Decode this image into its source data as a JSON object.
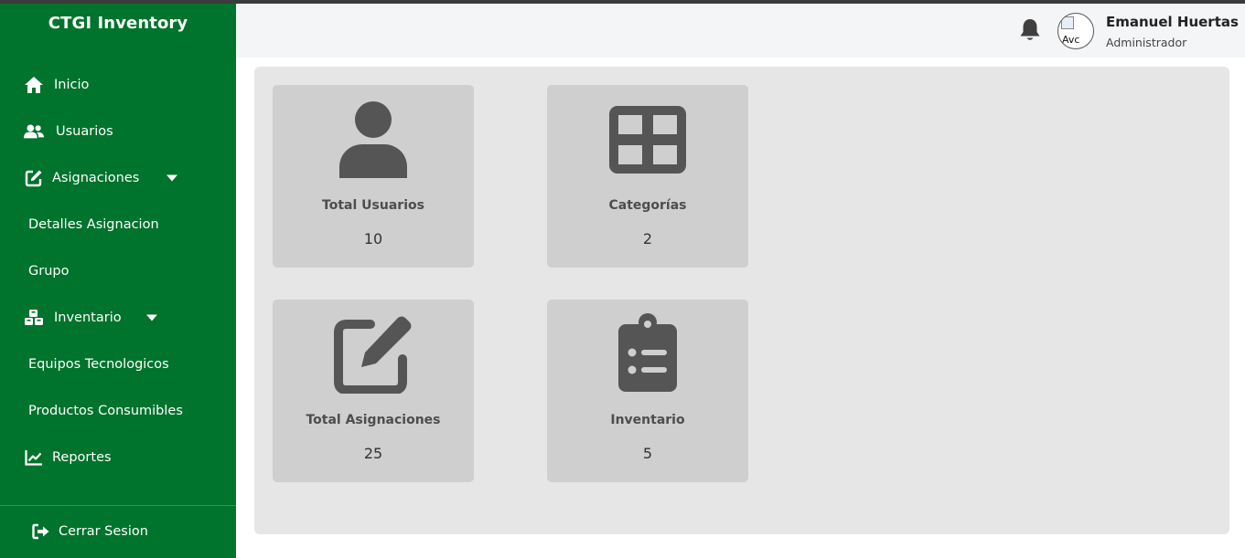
{
  "app": {
    "brand": "CTGI Inventory"
  },
  "sidebar": {
    "items": [
      {
        "label": "Inicio",
        "icon": "home-icon"
      },
      {
        "label": "Usuarios",
        "icon": "users-icon"
      },
      {
        "label": "Asignaciones",
        "icon": "edit-icon",
        "expandable": true
      },
      {
        "label": "Detalles Asignacion",
        "sub": true
      },
      {
        "label": "Grupo",
        "sub": true
      },
      {
        "label": "Inventario",
        "icon": "cubes-icon",
        "expandable": true
      },
      {
        "label": "Equipos Tecnologicos",
        "sub": true
      },
      {
        "label": "Productos Consumibles",
        "sub": true
      },
      {
        "label": "Reportes",
        "icon": "chart-line-icon"
      }
    ],
    "logout": {
      "label": "Cerrar Sesion",
      "icon": "sign-out-icon"
    }
  },
  "header": {
    "user_name": "Emanuel Huertas",
    "user_role": "Administrador",
    "avatar_alt": "Avc"
  },
  "cards": [
    {
      "title": "Total Usuarios",
      "value": "10",
      "icon": "user-icon"
    },
    {
      "title": "Categorías",
      "value": "2",
      "icon": "grid-icon"
    },
    {
      "title": "Total Asignaciones",
      "value": "25",
      "icon": "edit-icon"
    },
    {
      "title": "Inventario",
      "value": "5",
      "icon": "clipboard-list-icon"
    }
  ],
  "colors": {
    "sidebar": "#00732c",
    "card": "#cfcfcf",
    "panel": "#e6e6e6",
    "icon": "#555555"
  }
}
